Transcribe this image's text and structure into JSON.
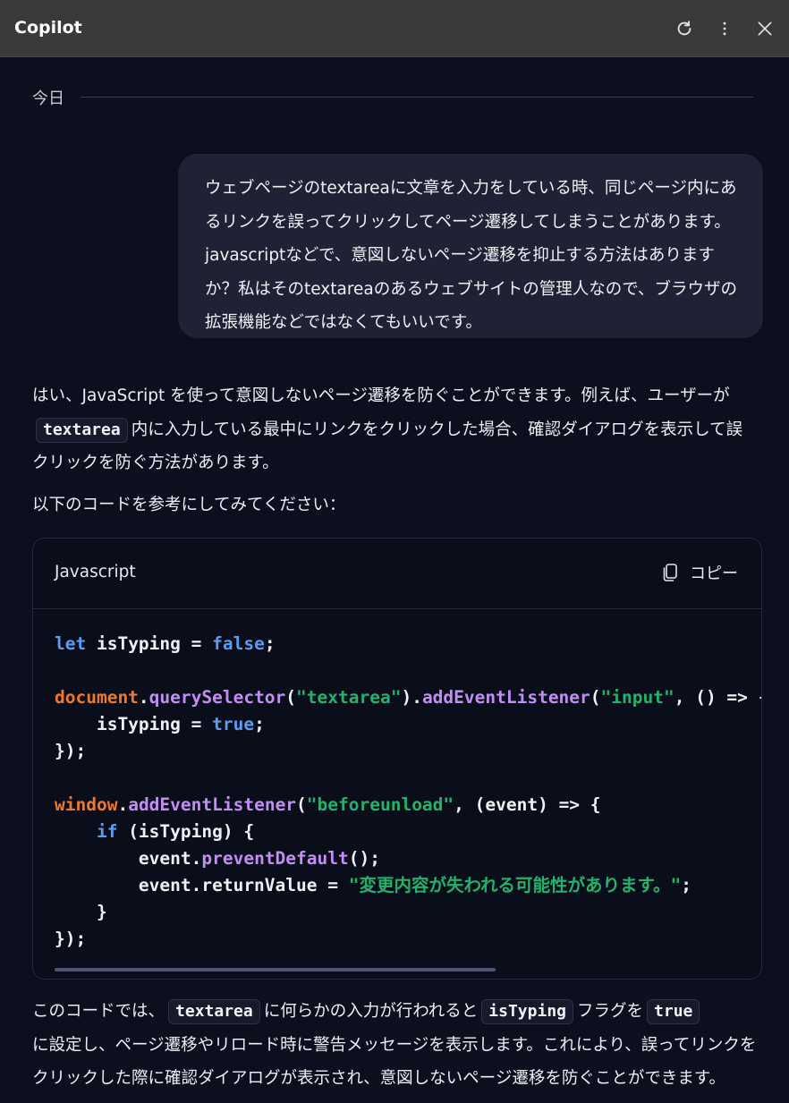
{
  "window": {
    "title": "Copilot"
  },
  "date_label": "今日",
  "user_message": "ウェブページのtextareaに文章を入力をしている時、同じページ内にあるリンクを誤ってクリックしてページ遷移してしまうことがあります。javascriptなどで、意図しないページ遷移を抑止する方法はありますか？私はそのtextareaのあるウェブサイトの管理人なので、ブラウザの拡張機能などではなくてもいいです。",
  "response": {
    "p1": {
      "a": "はい、JavaScript を使って意図しないページ遷移を防ぐことができます。例えば、ユーザーが",
      "code": "textarea",
      "b": "内に入力している最中にリンクをクリックした場合、確認ダイアログを表示して誤クリックを防ぐ方法があります。"
    },
    "p2": "以下のコードを参考にしてみてください：",
    "code_block": {
      "language": "Javascript",
      "copy_label": "コピー",
      "lines": [
        [
          {
            "t": "let",
            "c": "kw"
          },
          {
            "t": " isTyping = "
          },
          {
            "t": "false",
            "c": "kw"
          },
          {
            "t": ";"
          }
        ],
        [],
        [
          {
            "t": "document",
            "c": "obj"
          },
          {
            "t": "."
          },
          {
            "t": "querySelector",
            "c": "fn"
          },
          {
            "t": "("
          },
          {
            "t": "\"textarea\"",
            "c": "str"
          },
          {
            "t": ")."
          },
          {
            "t": "addEventListener",
            "c": "fn"
          },
          {
            "t": "("
          },
          {
            "t": "\"input\"",
            "c": "str"
          },
          {
            "t": ", () => {"
          }
        ],
        [
          {
            "t": "    isTyping = "
          },
          {
            "t": "true",
            "c": "kw"
          },
          {
            "t": ";"
          }
        ],
        [
          {
            "t": "});"
          }
        ],
        [],
        [
          {
            "t": "window",
            "c": "obj"
          },
          {
            "t": "."
          },
          {
            "t": "addEventListener",
            "c": "fn"
          },
          {
            "t": "("
          },
          {
            "t": "\"beforeunload\"",
            "c": "str"
          },
          {
            "t": ", (event) => {"
          }
        ],
        [
          {
            "t": "    "
          },
          {
            "t": "if",
            "c": "kw"
          },
          {
            "t": " (isTyping) {"
          }
        ],
        [
          {
            "t": "        event."
          },
          {
            "t": "preventDefault",
            "c": "fn"
          },
          {
            "t": "();"
          }
        ],
        [
          {
            "t": "        event.returnValue = "
          },
          {
            "t": "\"変更内容が失われる可能性があります。\"",
            "c": "str"
          },
          {
            "t": ";"
          }
        ],
        [
          {
            "t": "    }"
          }
        ],
        [
          {
            "t": "});"
          }
        ]
      ]
    },
    "p3": {
      "a": "このコードでは、",
      "code1": "textarea",
      "b": "に何らかの入力が行われると",
      "code2": "isTyping",
      "c": "フラグを",
      "code3": "true",
      "d": "に設定し、ページ遷移やリロード時に警告メッセージを表示します。これにより、誤ってリンクをクリックした際に確認ダイアログが表示され、意図しないページ遷移を防ぐことができます。"
    }
  },
  "icons": {
    "refresh": "refresh-icon",
    "more": "more-vertical-icon",
    "close": "close-icon",
    "copy": "copy-icon"
  }
}
